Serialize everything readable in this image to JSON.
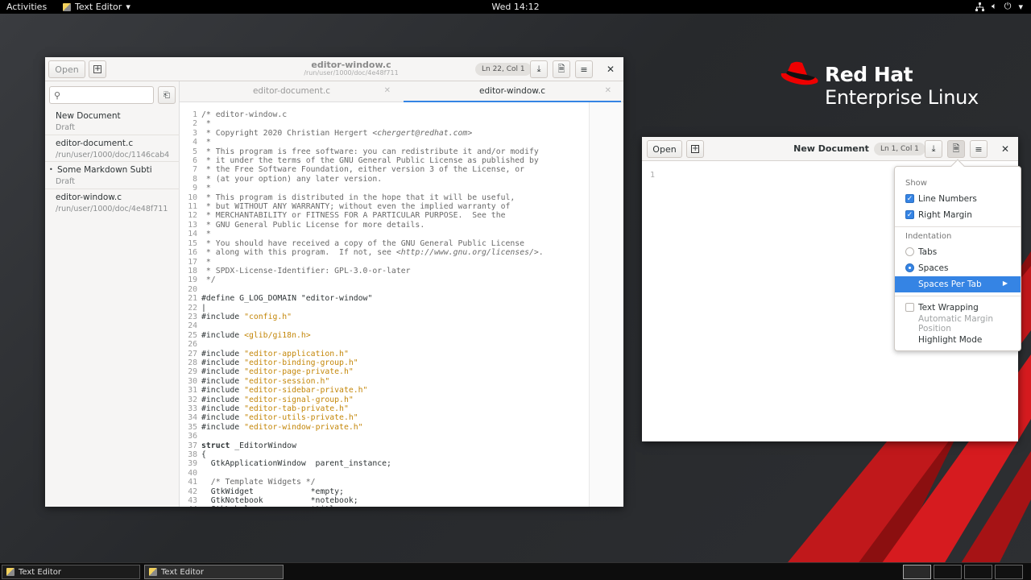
{
  "topbar": {
    "activities": "Activities",
    "app_menu": "Text Editor",
    "clock": "Wed 14:12",
    "tray_icons": [
      "network-icon",
      "volume-icon",
      "power-icon",
      "chevron-down-icon"
    ]
  },
  "logo": {
    "line1": "Red Hat",
    "line2": "Enterprise Linux"
  },
  "main_window": {
    "open_label": "Open",
    "title": "editor-window.c",
    "subtitle": "/run/user/1000/doc/4e48f711",
    "position": "Ln 22, Col 1",
    "search_placeholder": "",
    "documents": [
      {
        "name": "New Document",
        "sub": "Draft",
        "modified": false
      },
      {
        "name": "editor-document.c",
        "sub": "/run/user/1000/doc/1146cab4",
        "modified": false
      },
      {
        "name": "Some Markdown Subti",
        "sub": "Draft",
        "modified": true
      },
      {
        "name": "editor-window.c",
        "sub": "/run/user/1000/doc/4e48f711",
        "modified": false
      }
    ],
    "tabs": [
      {
        "label": "editor-document.c",
        "active": false
      },
      {
        "label": "editor-window.c",
        "active": true
      }
    ]
  },
  "second_window": {
    "open_label": "Open",
    "title": "New Document",
    "position": "Ln 1, Col 1",
    "line_number": "1"
  },
  "popover": {
    "show_header": "Show",
    "line_numbers": "Line Numbers",
    "right_margin": "Right Margin",
    "indentation_header": "Indentation",
    "tabs": "Tabs",
    "spaces": "Spaces",
    "spaces_per_tab": "Spaces Per Tab",
    "text_wrapping": "Text Wrapping",
    "auto_margin": "Automatic Margin Position",
    "highlight_mode": "Highlight Mode",
    "line_numbers_checked": true,
    "right_margin_checked": true,
    "text_wrapping_checked": false,
    "indentation_selected": "Spaces"
  },
  "taskbar": {
    "tasks": [
      "Text Editor",
      "Text Editor"
    ]
  },
  "colors": {
    "accent": "#3584e4",
    "string": "#c4870a",
    "redhat": "#ee0000"
  }
}
